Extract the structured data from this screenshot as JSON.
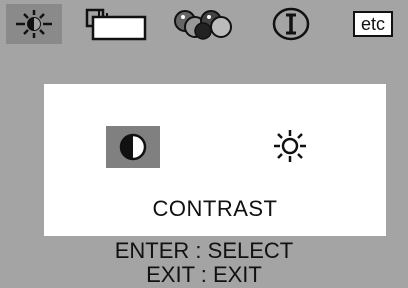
{
  "tabs": [
    {
      "name": "tab-picture",
      "icon": "brightness-sun-icon",
      "active": true
    },
    {
      "name": "tab-geometry",
      "icon": "window-position-icon",
      "active": false
    },
    {
      "name": "tab-color",
      "icon": "color-balls-icon",
      "active": false
    },
    {
      "name": "tab-information",
      "icon": "info-icon",
      "active": false
    },
    {
      "name": "tab-etc",
      "label": "etc",
      "active": false
    }
  ],
  "panel": {
    "selected_item": "contrast-icon",
    "items": [
      "contrast-icon",
      "brightness-icon"
    ],
    "label": "CONTRAST"
  },
  "help": {
    "line1": "ENTER : SELECT",
    "line2": "EXIT : EXIT"
  },
  "colors": {
    "background": "#a4a4a4",
    "active_tab": "#8a8a8a",
    "panel": "#ffffff",
    "selection": "#808080"
  }
}
